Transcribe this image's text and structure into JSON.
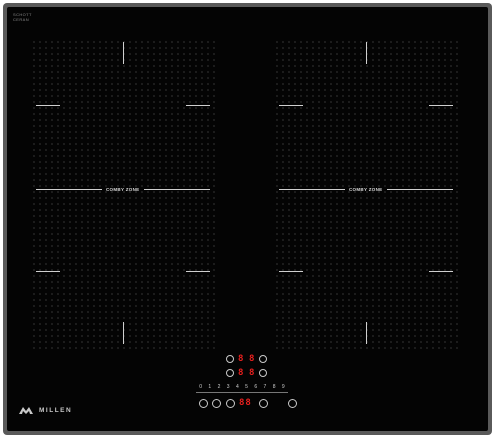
{
  "brand_top": {
    "line1": "SCHOTT",
    "line2": "CERAN"
  },
  "zones": [
    {
      "label": "COMBY ZONE"
    },
    {
      "label": "COMBY ZONE"
    }
  ],
  "controls": {
    "display_digits": [
      "8",
      "8"
    ],
    "timer_display": "88",
    "scale": [
      "0",
      "1",
      "2",
      "3",
      "4",
      "5",
      "6",
      "7",
      "8",
      "9"
    ]
  },
  "logo": {
    "text": "MILLEN"
  },
  "colors": {
    "glass": "#040404",
    "frame": "#5a5a5a",
    "display_red": "#e8201e",
    "line": "#cfcfcf"
  }
}
